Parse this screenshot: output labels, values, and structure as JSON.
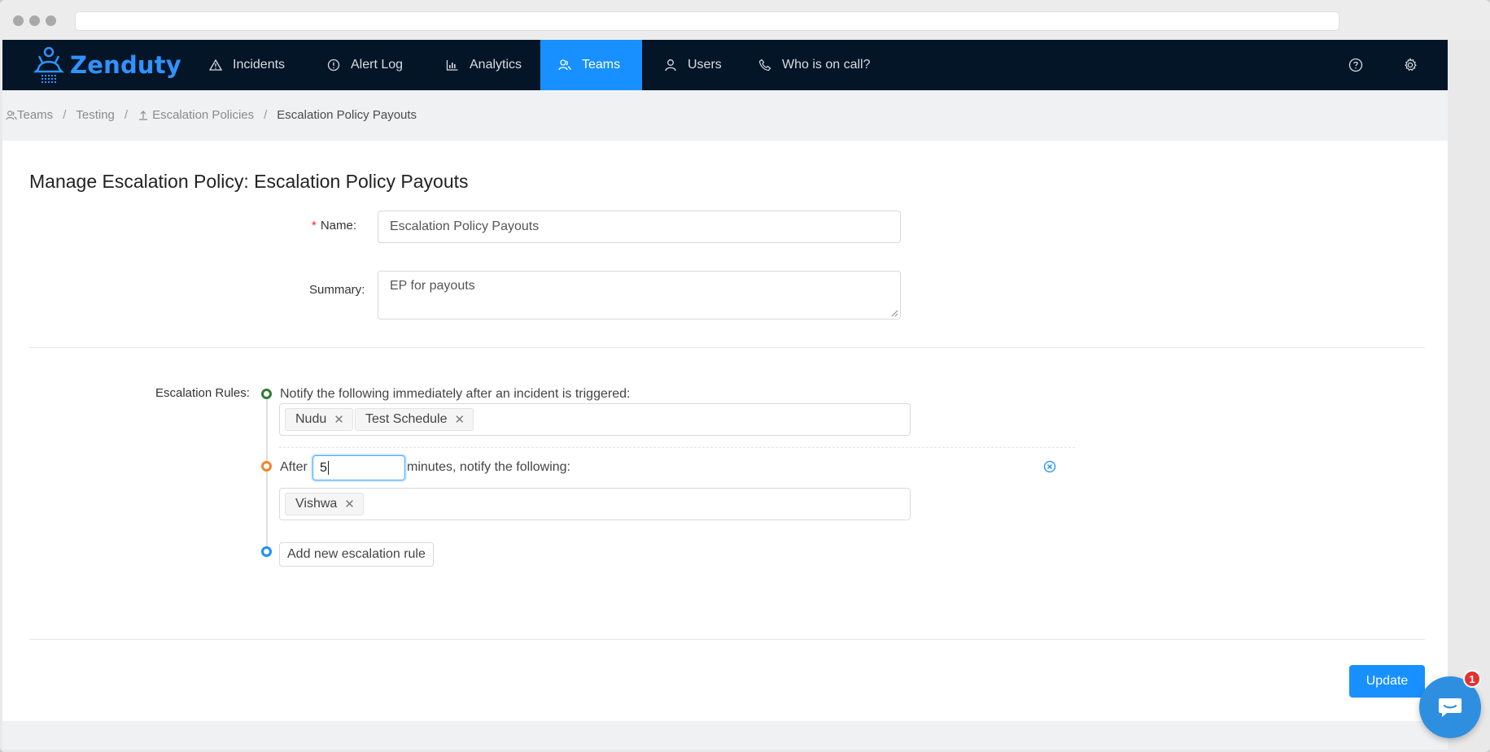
{
  "app": {
    "logo_text": "Zenduty",
    "brand_color": "#1890ff"
  },
  "nav": {
    "items": [
      {
        "label": "Incidents",
        "icon": "warning-triangle-icon"
      },
      {
        "label": "Alert Log",
        "icon": "info-circle-icon"
      },
      {
        "label": "Analytics",
        "icon": "bar-chart-icon"
      },
      {
        "label": "Teams",
        "icon": "team-icon",
        "active": true
      },
      {
        "label": "Users",
        "icon": "user-icon"
      },
      {
        "label": "Who is on call?",
        "icon": "phone-icon"
      }
    ],
    "tools": [
      "help-icon",
      "settings-gear-icon"
    ]
  },
  "breadcrumb": {
    "items": [
      "Teams",
      "Testing",
      "Escalation Policies",
      "Escalation Policy Payouts"
    ]
  },
  "page": {
    "title": "Manage Escalation Policy: Escalation Policy Payouts"
  },
  "form": {
    "name_label": "Name",
    "name_value": "Escalation Policy Payouts",
    "summary_label": "Summary",
    "summary_value": "EP for payouts",
    "rules_label": "Escalation Rules",
    "rules": [
      {
        "text": "Notify the following immediately after an incident is triggered:",
        "targets": [
          "Nudu",
          "Test Schedule"
        ],
        "dot_color": "#2e7d32"
      },
      {
        "prefix": "After",
        "delay_minutes": "5",
        "suffix": "minutes, notify the following:",
        "targets": [
          "Vishwa"
        ],
        "dot_color": "#f2852a"
      }
    ],
    "add_rule_label": "Add new escalation rule",
    "add_dot_color": "#1890ff",
    "update_label": "Update"
  },
  "chat_widget": {
    "badge_count": "1"
  }
}
